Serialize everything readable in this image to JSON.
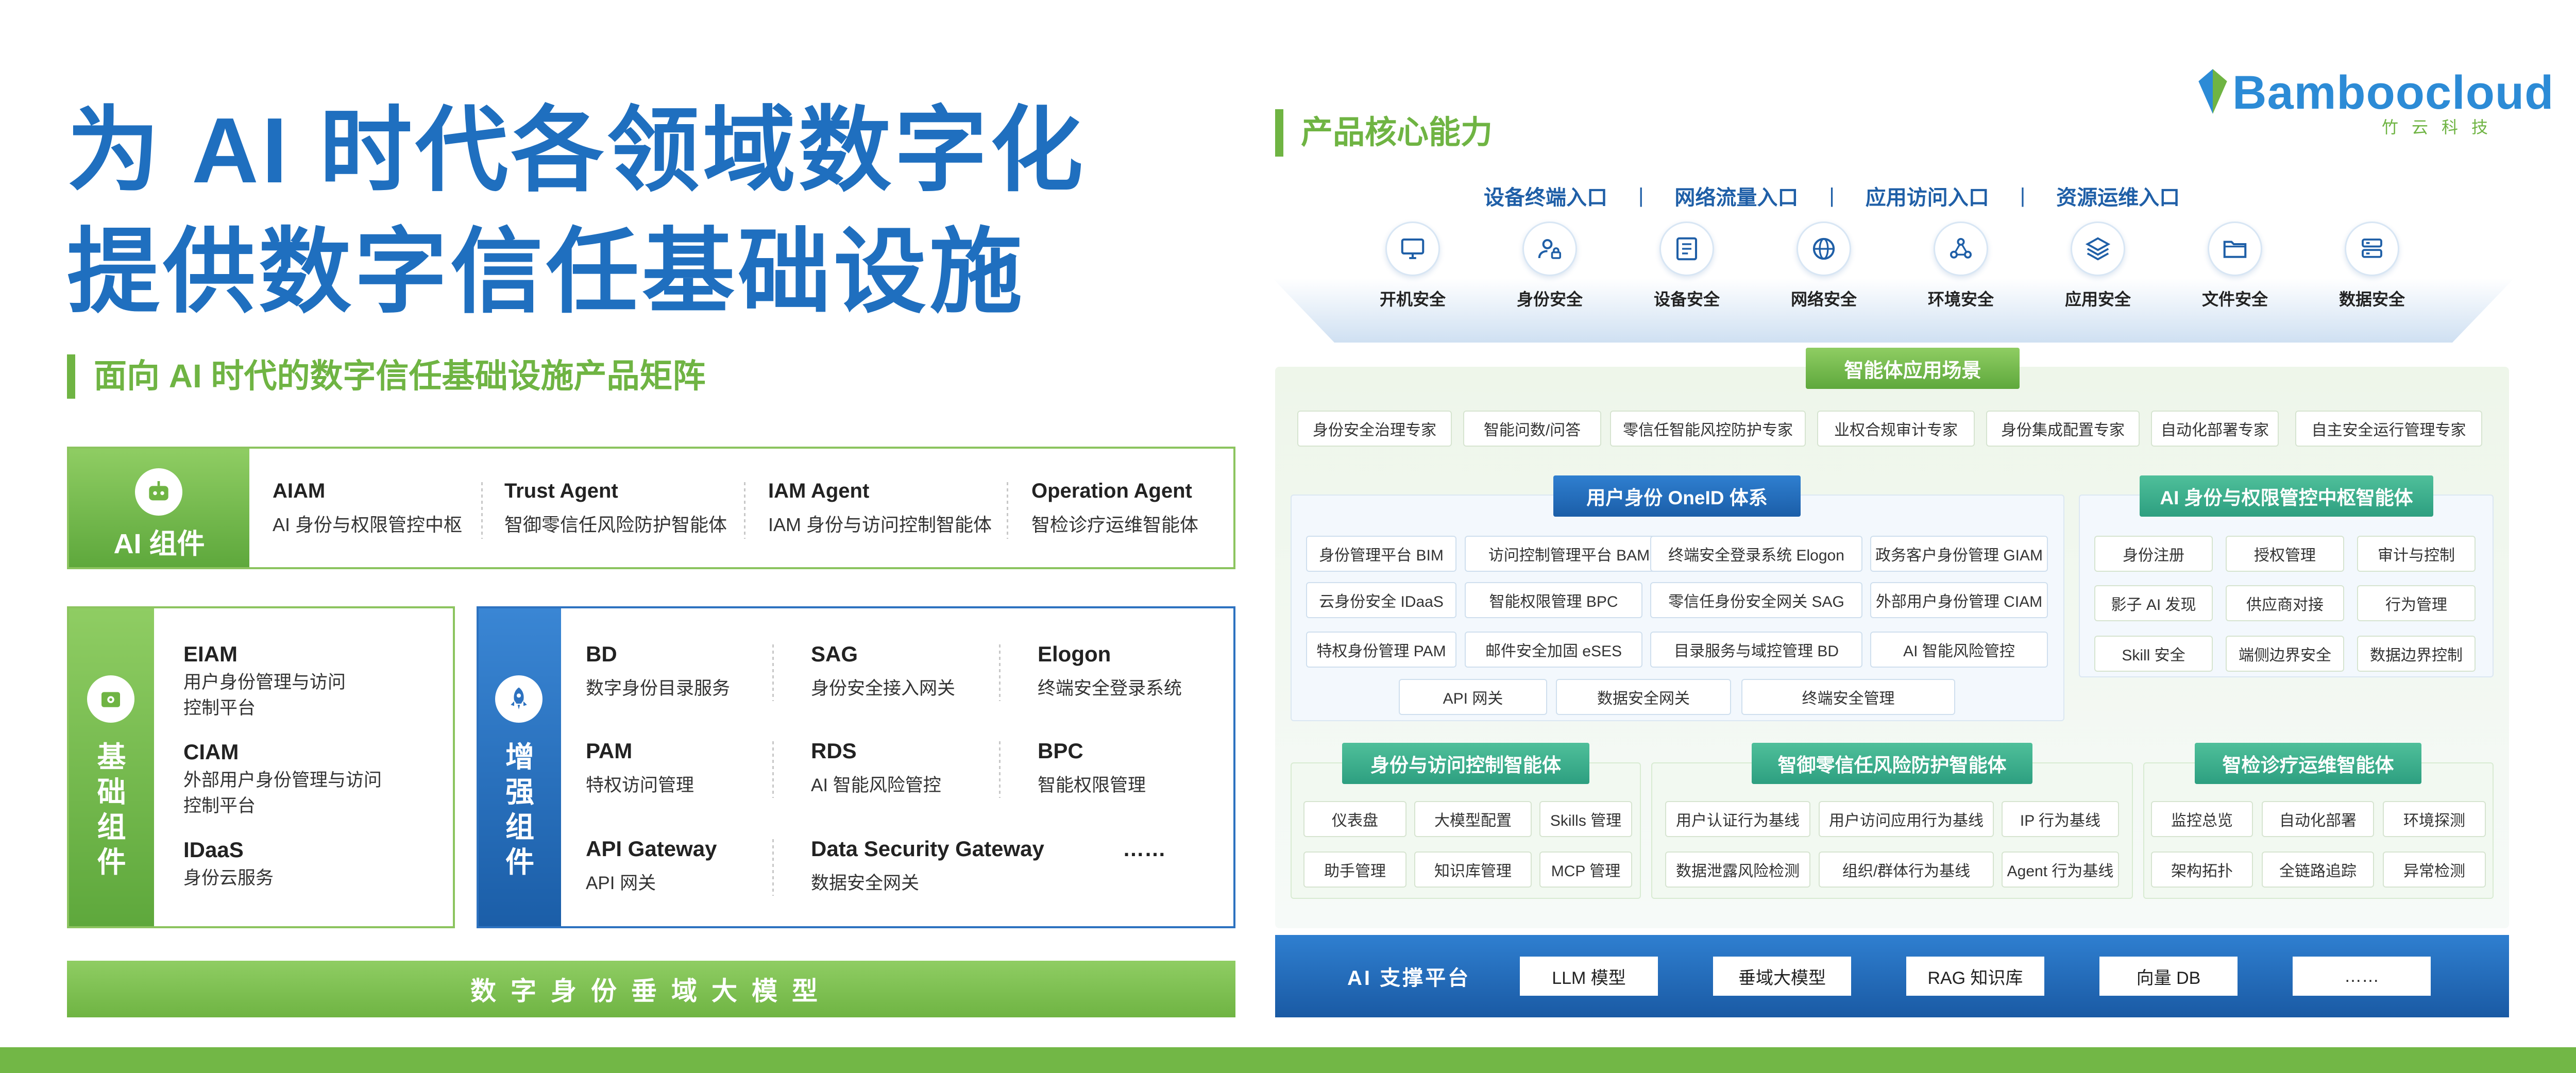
{
  "headline": {
    "line1": "为 AI 时代各领域数字化",
    "line2": "提供数字信任基础设施"
  },
  "matrix_title": "面向 AI 时代的数字信任基础设施产品矩阵",
  "ai_components": {
    "label": "AI 组件",
    "items": [
      {
        "title": "AIAM",
        "desc": "AI 身份与权限管控中枢"
      },
      {
        "title": "Trust Agent",
        "desc": "智御零信任风险防护智能体"
      },
      {
        "title": "IAM Agent",
        "desc": "IAM 身份与访问控制智能体"
      },
      {
        "title": "Operation Agent",
        "desc": "智检诊疗运维智能体"
      }
    ]
  },
  "base_components": {
    "label": [
      "基",
      "础",
      "组",
      "件"
    ],
    "items": [
      {
        "title": "EIAM",
        "desc1": "用户身份管理与访问",
        "desc2": "控制平台"
      },
      {
        "title": "CIAM",
        "desc1": "外部用户身份管理与访问",
        "desc2": "控制平台"
      },
      {
        "title": "IDaaS",
        "desc1": "身份云服务",
        "desc2": ""
      }
    ]
  },
  "enhanced_components": {
    "label": [
      "增",
      "强",
      "组",
      "件"
    ],
    "items": [
      {
        "title": "BD",
        "desc": "数字身份目录服务"
      },
      {
        "title": "SAG",
        "desc": "身份安全接入网关"
      },
      {
        "title": "Elogon",
        "desc": "终端安全登录系统"
      },
      {
        "title": "PAM",
        "desc": "特权访问管理"
      },
      {
        "title": "RDS",
        "desc": "AI 智能风险管控"
      },
      {
        "title": "BPC",
        "desc": "智能权限管理"
      },
      {
        "title": "API Gateway",
        "desc": "API 网关"
      },
      {
        "title": "Data Security Gateway",
        "desc": "数据安全网关"
      }
    ],
    "more": "……"
  },
  "bottom_banner": "数字身份垂域大模型",
  "logo": {
    "word": "Bamboocloud",
    "sub": "竹云科技"
  },
  "core_title": "产品核心能力",
  "entries": [
    "设备终端入口",
    "网络流量入口",
    "应用访问入口",
    "资源运维入口"
  ],
  "entry_sep": "|",
  "security_icons": [
    {
      "label": "开机安全",
      "icon": "monitor-icon"
    },
    {
      "label": "身份安全",
      "icon": "user-lock-icon"
    },
    {
      "label": "设备安全",
      "icon": "device-icon"
    },
    {
      "label": "网络安全",
      "icon": "globe-icon"
    },
    {
      "label": "环境安全",
      "icon": "nodes-icon"
    },
    {
      "label": "应用安全",
      "icon": "layers-icon"
    },
    {
      "label": "文件安全",
      "icon": "folder-icon"
    },
    {
      "label": "数据安全",
      "icon": "database-icon"
    }
  ],
  "scenarios": {
    "title": "智能体应用场景",
    "items": [
      "身份安全治理专家",
      "智能问数/问答",
      "零信任智能风控防护专家",
      "业权合规审计专家",
      "身份集成配置专家",
      "自动化部署专家",
      "自主安全运行管理专家"
    ]
  },
  "oneid": {
    "title": "用户身份 OneID 体系",
    "rows": [
      [
        "身份管理平台 BIM",
        "访问控制管理平台 BAM",
        "终端安全登录系统 Elogon",
        "政务客户身份管理 GIAM"
      ],
      [
        "云身份安全 IDaaS",
        "智能权限管理 BPC",
        "零信任身份安全网关 SAG",
        "外部用户身份管理 CIAM"
      ],
      [
        "特权身份管理 PAM",
        "邮件安全加固 eSES",
        "目录服务与域控管理 BD",
        "AI 智能风险管控"
      ],
      [
        "API 网关",
        "数据安全网关",
        "终端安全管理"
      ]
    ]
  },
  "ai_hub": {
    "title": "AI 身份与权限管控中枢智能体",
    "rows": [
      [
        "身份注册",
        "授权管理",
        "审计与控制"
      ],
      [
        "影子 AI 发现",
        "供应商对接",
        "行为管理"
      ],
      [
        "Skill 安全",
        "端侧边界安全",
        "数据边界控制"
      ]
    ]
  },
  "iam_agent": {
    "title": "身份与访问控制智能体",
    "rows": [
      [
        "仪表盘",
        "大模型配置",
        "Skills 管理"
      ],
      [
        "助手管理",
        "知识库管理",
        "MCP 管理"
      ]
    ]
  },
  "trust_agent": {
    "title": "智御零信任风险防护智能体",
    "rows": [
      [
        "用户认证行为基线",
        "用户访问应用行为基线",
        "IP 行为基线"
      ],
      [
        "数据泄露风险检测",
        "组织/群体行为基线",
        "Agent 行为基线"
      ]
    ]
  },
  "ops_agent": {
    "title": "智检诊疗运维智能体",
    "rows": [
      [
        "监控总览",
        "自动化部署",
        "环境探测"
      ],
      [
        "架构拓扑",
        "全链路追踪",
        "异常检测"
      ]
    ]
  },
  "ai_platform": {
    "label": "AI 支撑平台",
    "items": [
      "LLM 模型",
      "垂域大模型",
      "RAG 知识库",
      "向量 DB",
      "……"
    ]
  },
  "colors": {
    "blue": "#1f6fbf",
    "green": "#6fb443",
    "teal": "#2d9f80"
  }
}
